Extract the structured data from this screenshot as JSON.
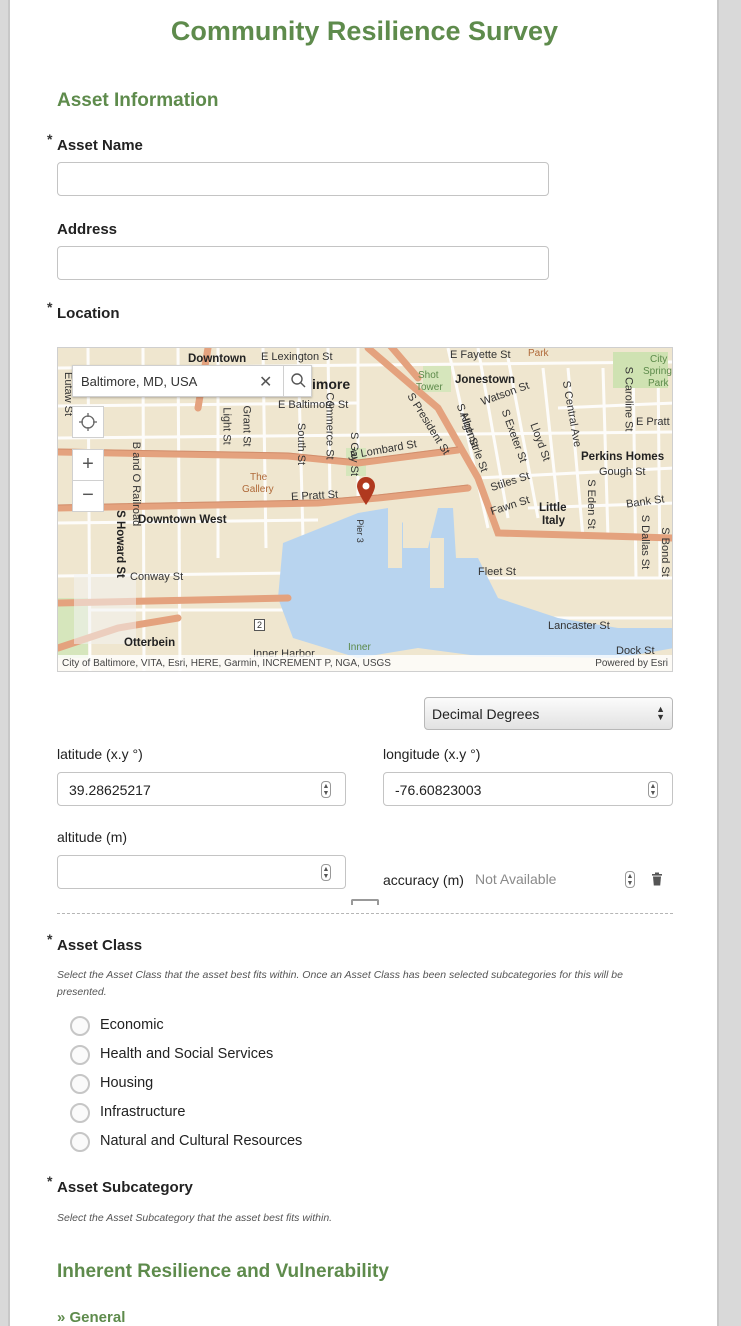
{
  "survey": {
    "title": "Community Resilience Survey"
  },
  "sections": {
    "asset_info": "Asset Information",
    "inherent": "Inherent Resilience and Vulnerability",
    "general_link": "» General"
  },
  "fields": {
    "required_mark": "*",
    "asset_name": {
      "label": "Asset Name",
      "value": ""
    },
    "address": {
      "label": "Address",
      "value": ""
    },
    "location": {
      "label": "Location"
    }
  },
  "map": {
    "search_value": "Baltimore, MD, USA",
    "attribution": "City of Baltimore, VITA, Esri, HERE, Garmin, INCREMENT P, NGA, USGS",
    "powered_by": "Powered by Esri",
    "labels": {
      "downtown": "Downtown",
      "lexington": "E Lexington St",
      "fayette": "E Fayette St",
      "park": "Park",
      "city_springs": "City",
      "city_springs2": "Springs",
      "city_springs3": "Park",
      "shot_tower": "Shot",
      "shot_tower2": "Tower",
      "jonestown": "Jonestown",
      "baltimore_frag": "imore",
      "e_baltimore": "E Baltimore St",
      "watson": "Watson St",
      "e_lombard": "E Lombard St",
      "s_president": "S President St",
      "perkins": "Perkins Homes",
      "gough": "Gough St",
      "e_pratt": "E Pratt",
      "the_gallery": "The",
      "the_gallery2": "Gallery",
      "e_pratt_st": "E Pratt St",
      "stiles": "Stiles St",
      "little_italy": "Little",
      "little_italy2": "Italy",
      "bank": "Bank St",
      "fawn": "Fawn St",
      "downtown_west": "Downtown West",
      "conway": "Conway St",
      "fleet": "Fleet St",
      "lancaster": "Lancaster St",
      "dock": "Dock St",
      "otterbein": "Otterbein",
      "inner_harbor": "Inner Harbor",
      "inner": "Inner",
      "pier3": "Pier 3",
      "grant": "Grant St",
      "light": "Light St",
      "south": "South St",
      "commerce": "Commerce St",
      "s_gay": "S Gay St",
      "s_howard": "S Howard St",
      "railroad": "B and O Railroad",
      "central": "S Central Ave",
      "caroline": "S Caroline St",
      "bond": "S Bond St",
      "dallas": "S Dallas St",
      "eden": "S Eden St",
      "exeter": "S Exeter St",
      "high": "S High St",
      "albemarle": "Albemarle St",
      "lloyd": "Lloyd St",
      "eutaw": "Eutaw St",
      "route": "2"
    }
  },
  "coords": {
    "format_select": "Decimal Degrees",
    "latitude": {
      "label": "latitude (x.y °)",
      "value": "39.28625217"
    },
    "longitude": {
      "label": "longitude (x.y °)",
      "value": "-76.60823003"
    },
    "altitude": {
      "label": "altitude (m)",
      "value": ""
    },
    "accuracy": {
      "label": "accuracy (m)",
      "value": "Not Available"
    }
  },
  "asset_class": {
    "label": "Asset Class",
    "hint": "Select the Asset Class that the asset best fits within. Once an Asset Class has been selected subcategories for this will be presented.",
    "options": [
      "Economic",
      "Health and Social Services",
      "Housing",
      "Infrastructure",
      "Natural and Cultural Resources"
    ]
  },
  "asset_subcategory": {
    "label": "Asset Subcategory",
    "hint": "Select the Asset Subcategory that the asset best fits within."
  },
  "colors": {
    "accent_green": "#5e8b4c",
    "map_road": "#e4a27e",
    "map_water": "#b8d4ef",
    "pin": "#b0391f"
  },
  "icons": {
    "search": "search-icon",
    "clear": "close-icon",
    "locate": "locate-icon",
    "zoom_in": "zoom-in-icon",
    "zoom_out": "zoom-out-icon",
    "pin": "map-pin-icon",
    "delete": "trash-icon"
  }
}
